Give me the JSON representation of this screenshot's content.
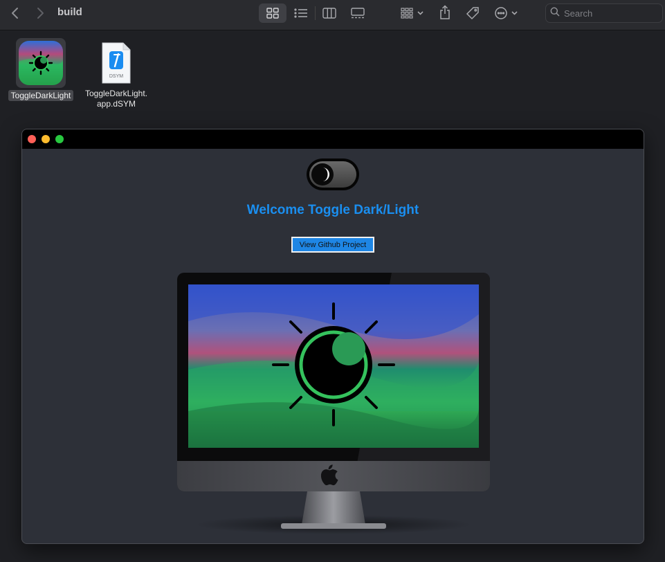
{
  "finder": {
    "folder_title": "build",
    "search_placeholder": "Search",
    "icons": {
      "back": "chevron-left-icon",
      "forward": "chevron-right-icon",
      "icon_view": "grid-icon",
      "list_view": "list-icon",
      "column_view": "columns-icon",
      "gallery_view": "gallery-icon",
      "group": "group-icon",
      "share": "share-icon",
      "tag": "tag-icon",
      "more": "ellipsis-circle-icon",
      "search": "magnifier-icon"
    },
    "files": [
      {
        "name": "ToggleDarkLight",
        "selected": true
      },
      {
        "name_line1": "ToggleDarkLight.",
        "name_line2": "app.dSYM",
        "badge": "DSYM"
      }
    ]
  },
  "app_window": {
    "welcome_text": "Welcome Toggle Dark/Light",
    "github_button": "View Github Project",
    "toggle_state": "dark",
    "colors": {
      "accent": "#1a8ff1",
      "button": "#1e86e5",
      "window_bg": "#2d3038",
      "titlebar": "#000000"
    }
  }
}
